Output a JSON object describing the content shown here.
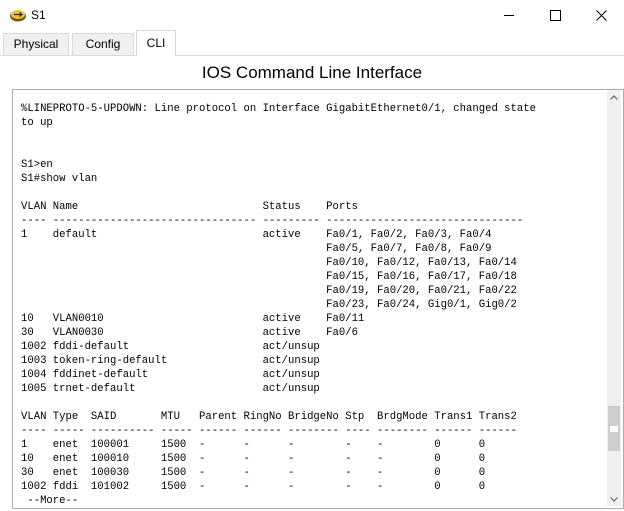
{
  "window": {
    "title": "S1",
    "app_icon": "packet-tracer-switch-icon"
  },
  "tabs": [
    {
      "label": "Physical",
      "active": false
    },
    {
      "label": "Config",
      "active": false
    },
    {
      "label": "CLI",
      "active": true
    }
  ],
  "cli": {
    "heading": "IOS Command Line Interface",
    "output": "%LINEPROTO-5-UPDOWN: Line protocol on Interface GigabitEthernet0/1, changed state\nto up\n\n\nS1>en\nS1#show vlan\n\nVLAN Name                             Status    Ports\n---- -------------------------------- --------- -------------------------------\n1    default                          active    Fa0/1, Fa0/2, Fa0/3, Fa0/4\n                                                Fa0/5, Fa0/7, Fa0/8, Fa0/9\n                                                Fa0/10, Fa0/12, Fa0/13, Fa0/14\n                                                Fa0/15, Fa0/16, Fa0/17, Fa0/18\n                                                Fa0/19, Fa0/20, Fa0/21, Fa0/22\n                                                Fa0/23, Fa0/24, Gig0/1, Gig0/2\n10   VLAN0010                         active    Fa0/11\n30   VLAN0030                         active    Fa0/6\n1002 fddi-default                     act/unsup\n1003 token-ring-default               act/unsup\n1004 fddinet-default                  act/unsup\n1005 trnet-default                    act/unsup\n\nVLAN Type  SAID       MTU   Parent RingNo BridgeNo Stp  BrdgMode Trans1 Trans2\n---- ----- ---------- ----- ------ ------ -------- ---- -------- ------ ------\n1    enet  100001     1500  -      -      -        -    -        0      0\n10   enet  100010     1500  -      -      -        -    -        0      0\n30   enet  100030     1500  -      -      -        -    -        0      0\n1002 fddi  101002     1500  -      -      -        -    -        0      0\n --More-- "
  },
  "scrollbar": {
    "position": 0.88
  }
}
